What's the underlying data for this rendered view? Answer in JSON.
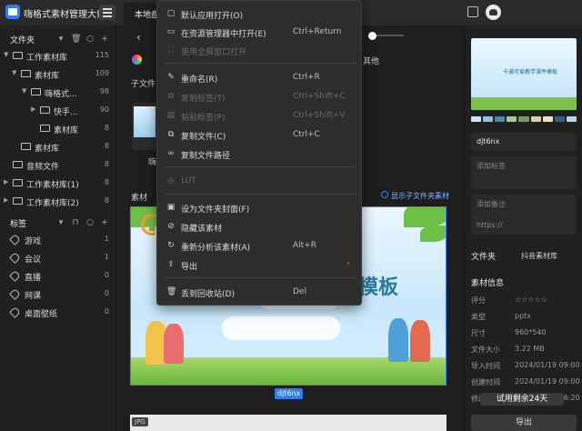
{
  "app": {
    "title": "嗨格式素材管理大师",
    "tab": "本地盘"
  },
  "sidebar": {
    "folders_title": "文件夹",
    "folders": [
      {
        "label": "工作素材库",
        "count": "115"
      },
      {
        "label": "素材库",
        "count": "109"
      },
      {
        "label": "嗨格式...",
        "count": "98"
      },
      {
        "label": "快手...",
        "count": "90"
      },
      {
        "label": "素材库",
        "count": "8"
      },
      {
        "label": "素材库",
        "count": "8"
      },
      {
        "label": "音频文件",
        "count": "8"
      },
      {
        "label": "工作素材库(1)",
        "count": "8"
      },
      {
        "label": "工作素材库(2)",
        "count": "8"
      }
    ],
    "tags_title": "标签",
    "tags": [
      {
        "label": "游戏",
        "count": "1"
      },
      {
        "label": "会议",
        "count": "1"
      },
      {
        "label": "直播",
        "count": "0"
      },
      {
        "label": "网课",
        "count": "0"
      },
      {
        "label": "桌面壁纸",
        "count": "0"
      }
    ]
  },
  "center": {
    "other_label": "其他",
    "subfolder_label": "子文件",
    "thumb_small_label": "嗨",
    "material_label": "素材",
    "show_sub_label": "显示子文件夹素材",
    "big_thumb_title": "模板",
    "file_name": "djt6nx",
    "next_type": "JPG"
  },
  "context_menu": {
    "items": [
      {
        "label": "默认应用打开(O)",
        "shortcut": "",
        "disabled": false,
        "icon": "open-app-icon"
      },
      {
        "label": "在资源管理器中打开(E)",
        "shortcut": "Ctrl+Return",
        "disabled": false,
        "icon": "folder-open-icon"
      },
      {
        "label": "使用全屏窗口打开",
        "shortcut": "",
        "disabled": true,
        "icon": "fullscreen-icon"
      },
      {
        "label": "重命名(R)",
        "shortcut": "Ctrl+R",
        "disabled": false,
        "icon": "rename-icon"
      },
      {
        "label": "复制标签(T)",
        "shortcut": "Ctrl+Shift+C",
        "disabled": true,
        "icon": "copy-tag-icon"
      },
      {
        "label": "粘贴标签(P)",
        "shortcut": "Ctrl+Shift+V",
        "disabled": true,
        "icon": "paste-tag-icon"
      },
      {
        "label": "复制文件(C)",
        "shortcut": "Ctrl+C",
        "disabled": false,
        "icon": "copy-file-icon"
      },
      {
        "label": "复制文件路径",
        "shortcut": "",
        "disabled": false,
        "icon": "copy-path-icon"
      },
      {
        "label": "LUT",
        "shortcut": "",
        "disabled": true,
        "icon": "lut-icon"
      },
      {
        "label": "设为文件夹封面(F)",
        "shortcut": "",
        "disabled": false,
        "icon": "cover-icon"
      },
      {
        "label": "隐藏该素材",
        "shortcut": "",
        "disabled": false,
        "icon": "hide-icon"
      },
      {
        "label": "重新分析该素材(A)",
        "shortcut": "Alt+R",
        "disabled": false,
        "icon": "reanalyze-icon"
      },
      {
        "label": "导出",
        "shortcut": "",
        "disabled": false,
        "icon": "export-icon",
        "submenu": true
      },
      {
        "label": "丢到回收站(D)",
        "shortcut": "Del",
        "disabled": false,
        "icon": "trash-icon"
      }
    ]
  },
  "right_panel": {
    "preview_title": "卡通可爱教学课件模板",
    "swatches": [
      "#cfe6f2",
      "#8fc1d9",
      "#4d8aa8",
      "#a9c98f",
      "#6f9f5a",
      "#d8cfa8",
      "#e7e2cf",
      "#3d5f73",
      "#b7d6e6"
    ],
    "name": "djt6nx",
    "tag_placeholder": "添加标签",
    "note_placeholder": "添加备注",
    "url_placeholder": "https://",
    "folder_title": "文件夹",
    "folder_value": "抖音素材库",
    "info_title": "素材信息",
    "info": [
      {
        "k": "评分",
        "v": "☆☆☆☆☆"
      },
      {
        "k": "类型",
        "v": "pptx"
      },
      {
        "k": "尺寸",
        "v": "960*540"
      },
      {
        "k": "文件大小",
        "v": "3.22 MB"
      },
      {
        "k": "导入时间",
        "v": "2024/01/19 09:00"
      },
      {
        "k": "创建时间",
        "v": "2024/01/19 09:00"
      },
      {
        "k": "修改日期",
        "v": "2024/01/19 16:20"
      }
    ],
    "trial": "试用剩余24天",
    "export": "导出"
  }
}
